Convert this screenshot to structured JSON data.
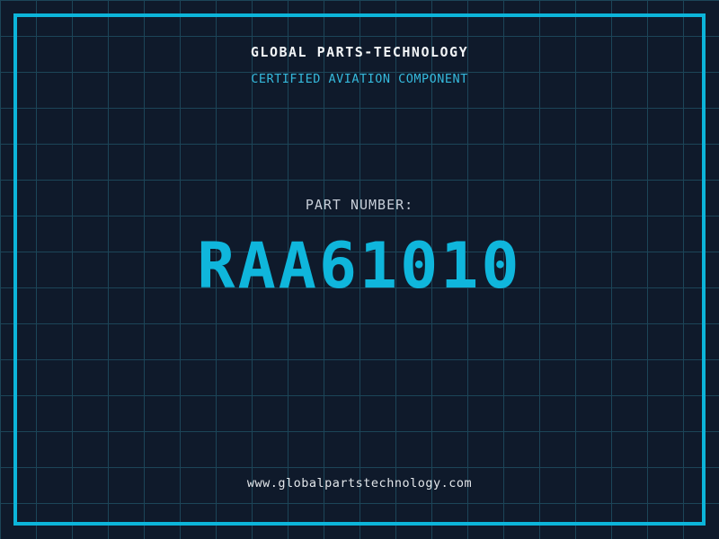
{
  "header": {
    "title": "GLOBAL PARTS-TECHNOLOGY",
    "subtitle": "CERTIFIED AVIATION COMPONENT"
  },
  "part": {
    "label": "PART NUMBER:",
    "number": "RAA61010"
  },
  "footer": {
    "url": "www.globalpartstechnology.com"
  },
  "colors": {
    "background": "#0f1a2b",
    "grid_line": "#1c4558",
    "frame": "#0cb5da",
    "accent_cyan": "#35b9dc",
    "number_cyan": "#0fb6dc",
    "title_white": "#f2f5f7",
    "label_gray": "#c7ced8",
    "url_gray": "#e2e6ea"
  }
}
